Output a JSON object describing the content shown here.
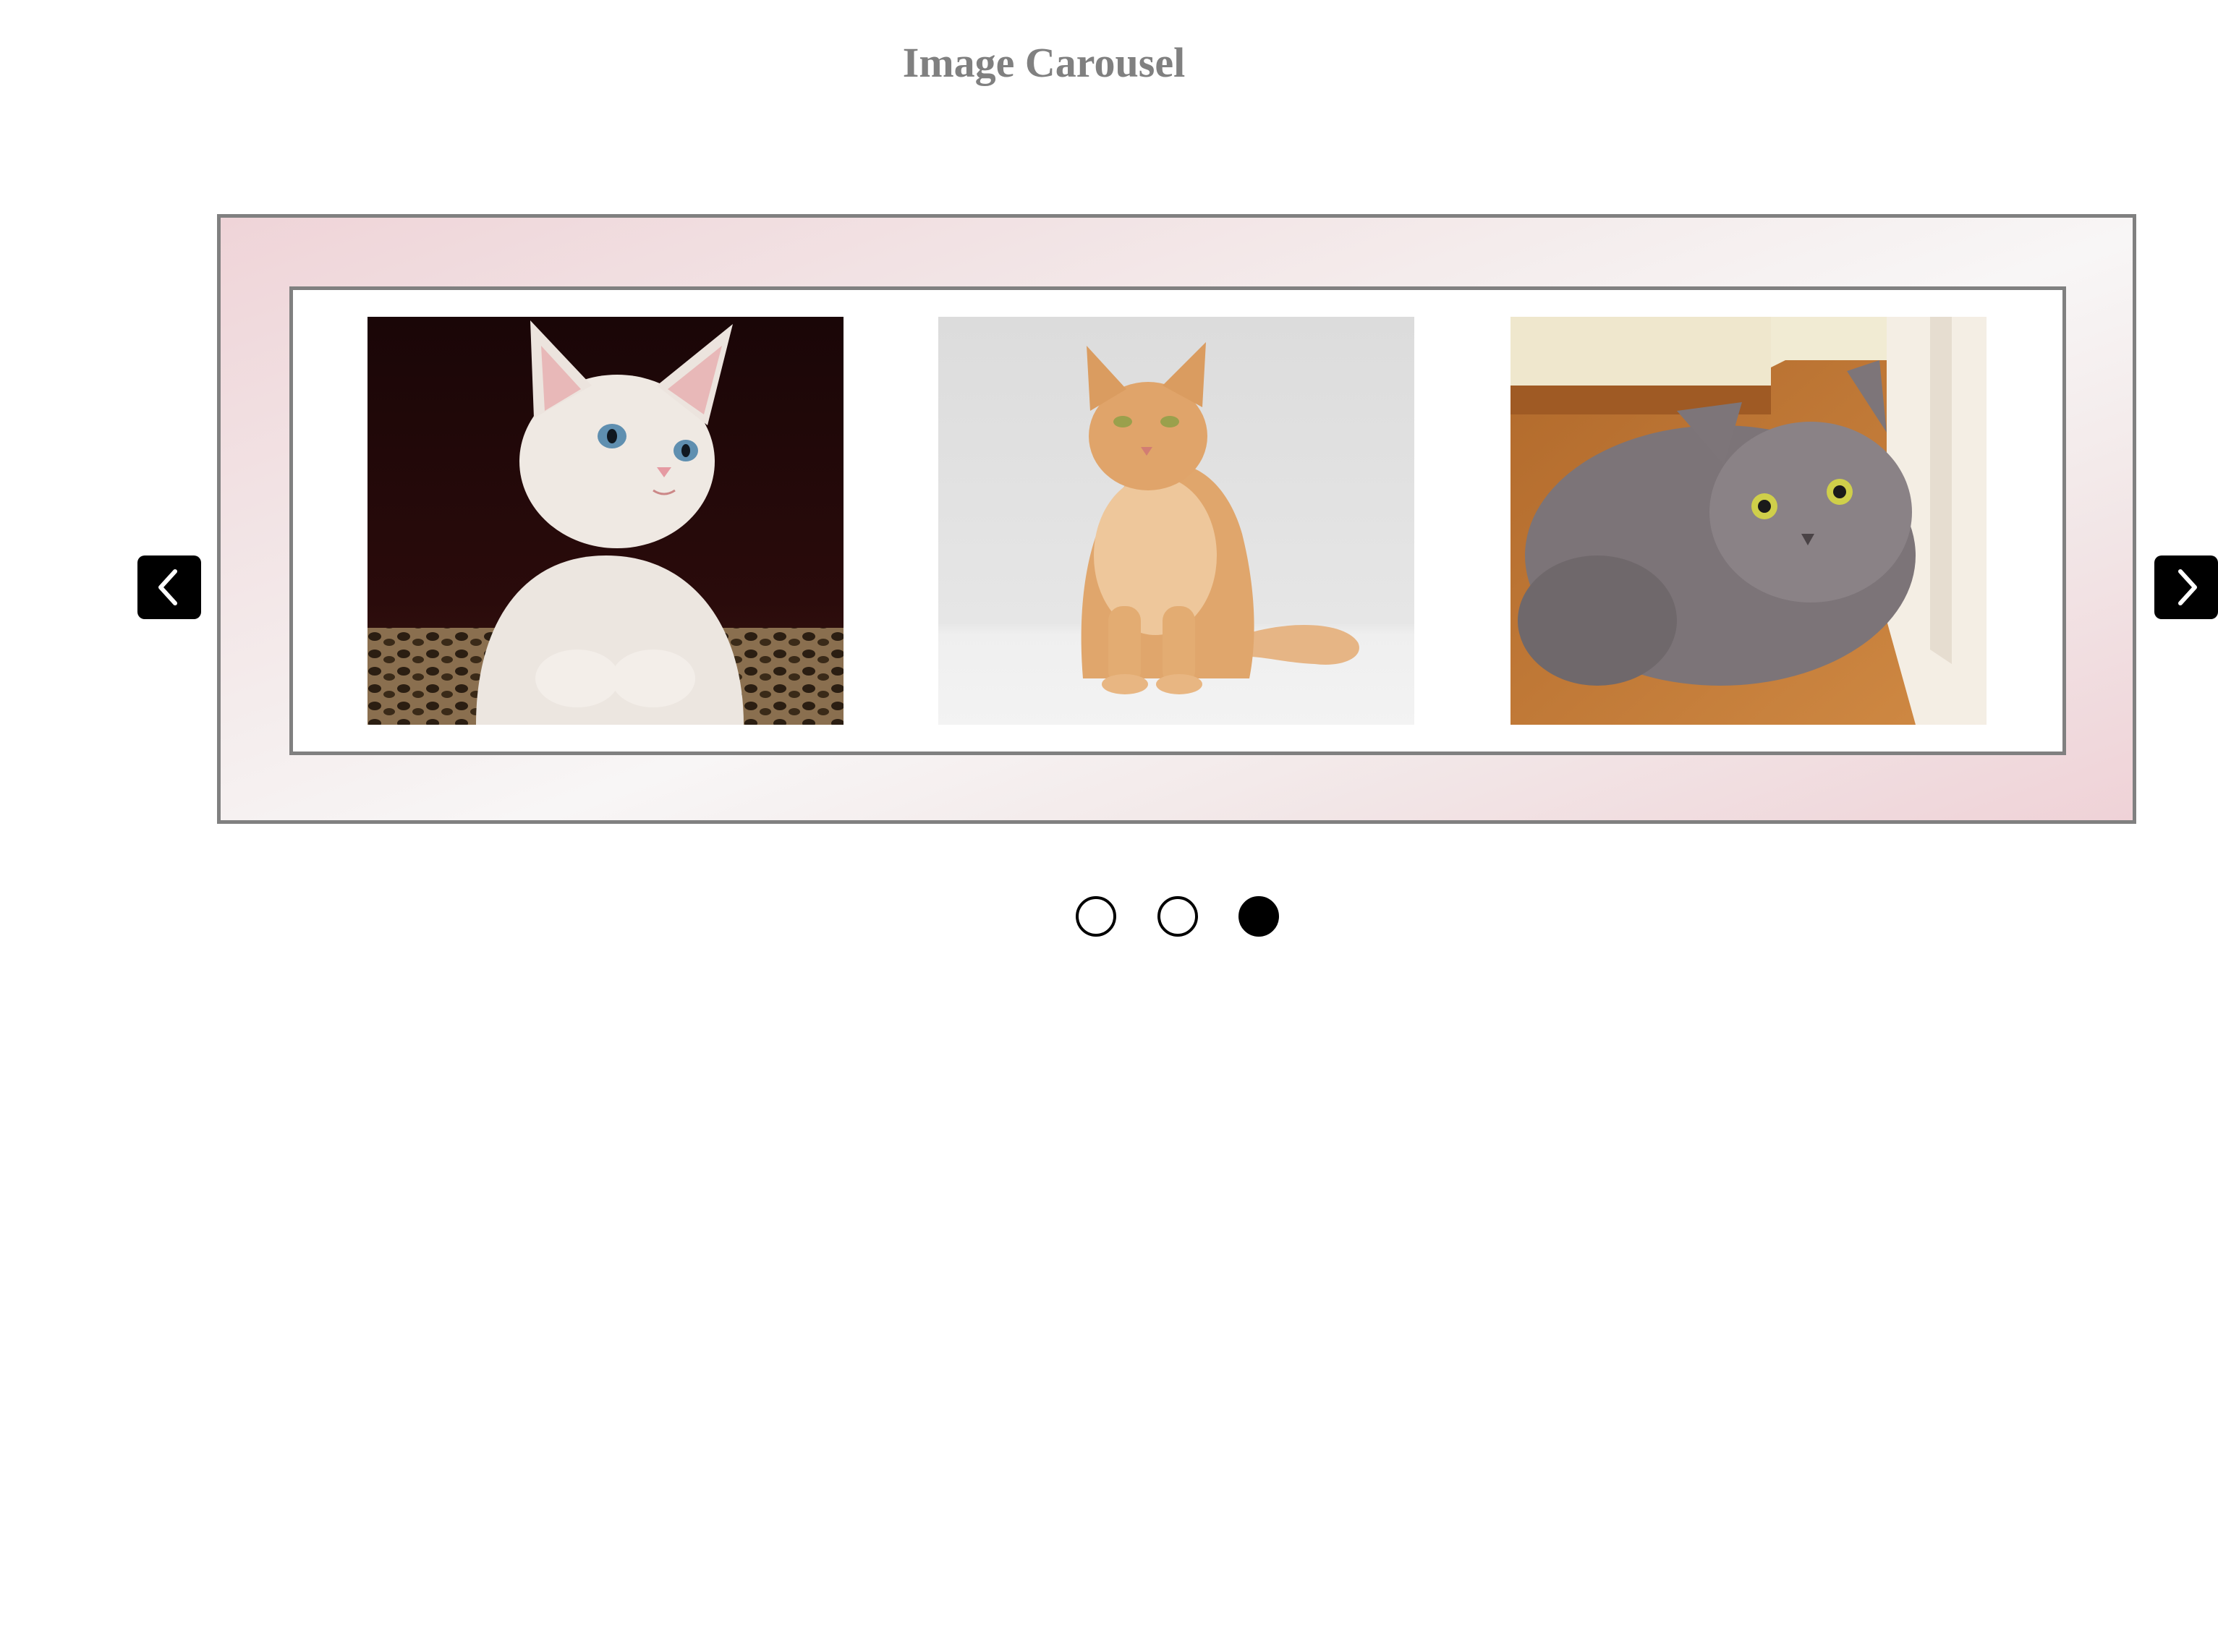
{
  "page": {
    "title": "Image Carousel"
  },
  "carousel": {
    "slides": [
      {
        "subject": "white-kitten-photo"
      },
      {
        "subject": "orange-cat-photo"
      },
      {
        "subject": "gray-cat-photo"
      }
    ],
    "prev_icon": "chevron-left-icon",
    "next_icon": "chevron-right-icon",
    "active_index": 3,
    "dots": [
      {
        "active": false
      },
      {
        "active": false
      },
      {
        "active": true
      }
    ]
  },
  "colors": {
    "title": "#808080",
    "frame_border": "#808080",
    "frame_gradient_pink": "#efd4d8",
    "nav_button": "#000000",
    "dot_active": "#000000"
  }
}
